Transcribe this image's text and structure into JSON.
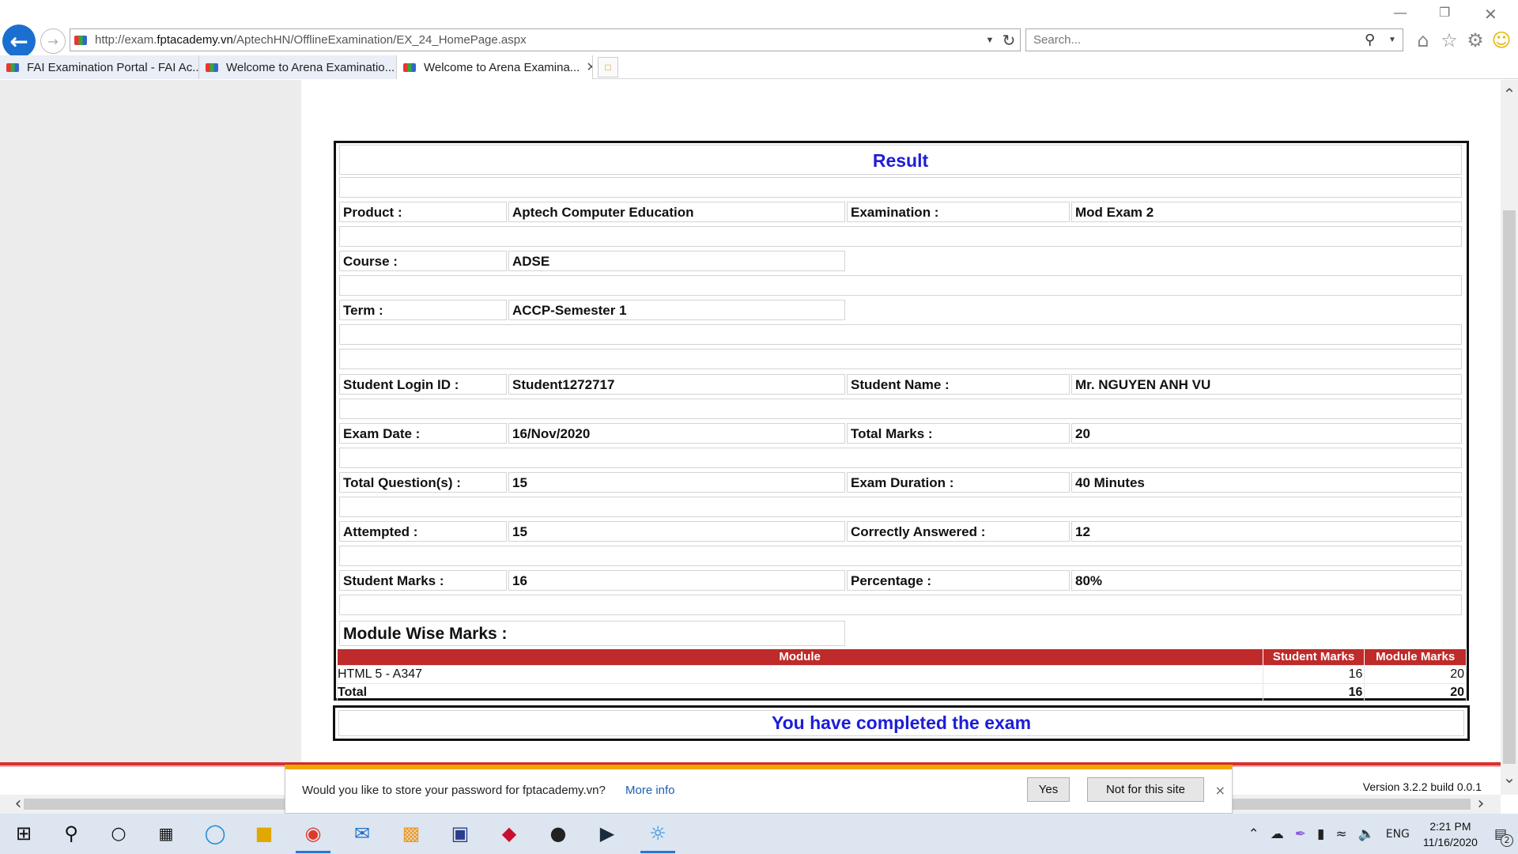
{
  "browser": {
    "url_prefix": "http://exam.",
    "url_domain": "fptacademy.vn",
    "url_path": "/AptechHN/OfflineExamination/EX_24_HomePage.aspx",
    "search_placeholder": "Search...",
    "tabs": [
      {
        "label": "FAI Examination Portal - FAI Ac..."
      },
      {
        "label": "Welcome to Arena Examinatio..."
      },
      {
        "label": "Welcome to Arena Examina..."
      }
    ]
  },
  "result": {
    "title": "Result",
    "product_label": "Product :",
    "product_value": "Aptech Computer Education",
    "examination_label": "Examination :",
    "examination_value": "Mod Exam 2",
    "course_label": "Course :",
    "course_value": "ADSE",
    "term_label": "Term :",
    "term_value": "ACCP-Semester 1",
    "login_label": "Student Login ID :",
    "login_value": "Student1272717",
    "name_label": "Student Name :",
    "name_value": "Mr. NGUYEN ANH VU",
    "date_label": "Exam Date :",
    "date_value": "16/Nov/2020",
    "total_marks_label": "Total Marks :",
    "total_marks_value": "20",
    "questions_label": "Total Question(s) :",
    "questions_value": "15",
    "duration_label": "Exam Duration :",
    "duration_value": "40 Minutes",
    "attempted_label": "Attempted :",
    "attempted_value": "15",
    "correct_label": "Correctly Answered :",
    "correct_value": "12",
    "student_marks_label": "Student Marks :",
    "student_marks_value": "16",
    "percentage_label": "Percentage :",
    "percentage_value": "80%",
    "module_heading": "Module Wise Marks :",
    "table": {
      "headers": [
        "Module",
        "Student Marks",
        "Module Marks"
      ],
      "row": [
        "HTML 5 - A347",
        "16",
        "20"
      ],
      "total": [
        "Total",
        "16",
        "20"
      ]
    }
  },
  "completed_message": "You have completed the exam",
  "version": "Version 3.2.2 build 0.0.1",
  "password_prompt": {
    "message": "Would you like to store your password for fptacademy.vn?",
    "more_info": "More info",
    "yes": "Yes",
    "no": "Not for this site"
  },
  "taskbar": {
    "language": "ENG",
    "time": "2:21 PM",
    "date": "11/16/2020",
    "notifications": "2"
  }
}
